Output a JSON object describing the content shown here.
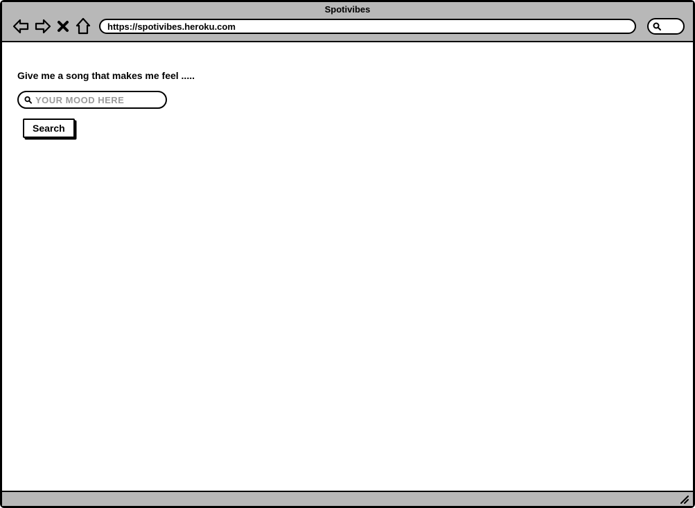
{
  "browser": {
    "title": "Spotivibes",
    "url": "https://spotivibes.heroku.com"
  },
  "page": {
    "prompt": "Give me a song that makes me feel .....",
    "mood_placeholder": "YOUR MOOD HERE",
    "search_button": "Search"
  }
}
